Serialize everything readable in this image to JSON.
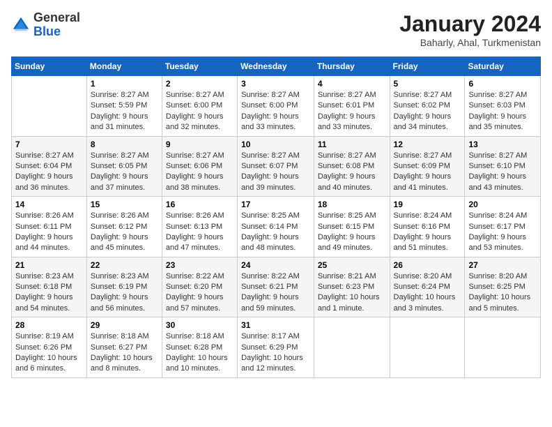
{
  "header": {
    "logo": {
      "general": "General",
      "blue": "Blue"
    },
    "title": "January 2024",
    "location": "Baharly, Ahal, Turkmenistan"
  },
  "weekdays": [
    "Sunday",
    "Monday",
    "Tuesday",
    "Wednesday",
    "Thursday",
    "Friday",
    "Saturday"
  ],
  "weeks": [
    [
      {
        "day": "",
        "sunrise": "",
        "sunset": "",
        "daylight": ""
      },
      {
        "day": "1",
        "sunrise": "Sunrise: 8:27 AM",
        "sunset": "Sunset: 5:59 PM",
        "daylight": "Daylight: 9 hours and 31 minutes."
      },
      {
        "day": "2",
        "sunrise": "Sunrise: 8:27 AM",
        "sunset": "Sunset: 6:00 PM",
        "daylight": "Daylight: 9 hours and 32 minutes."
      },
      {
        "day": "3",
        "sunrise": "Sunrise: 8:27 AM",
        "sunset": "Sunset: 6:00 PM",
        "daylight": "Daylight: 9 hours and 33 minutes."
      },
      {
        "day": "4",
        "sunrise": "Sunrise: 8:27 AM",
        "sunset": "Sunset: 6:01 PM",
        "daylight": "Daylight: 9 hours and 33 minutes."
      },
      {
        "day": "5",
        "sunrise": "Sunrise: 8:27 AM",
        "sunset": "Sunset: 6:02 PM",
        "daylight": "Daylight: 9 hours and 34 minutes."
      },
      {
        "day": "6",
        "sunrise": "Sunrise: 8:27 AM",
        "sunset": "Sunset: 6:03 PM",
        "daylight": "Daylight: 9 hours and 35 minutes."
      }
    ],
    [
      {
        "day": "7",
        "sunrise": "Sunrise: 8:27 AM",
        "sunset": "Sunset: 6:04 PM",
        "daylight": "Daylight: 9 hours and 36 minutes."
      },
      {
        "day": "8",
        "sunrise": "Sunrise: 8:27 AM",
        "sunset": "Sunset: 6:05 PM",
        "daylight": "Daylight: 9 hours and 37 minutes."
      },
      {
        "day": "9",
        "sunrise": "Sunrise: 8:27 AM",
        "sunset": "Sunset: 6:06 PM",
        "daylight": "Daylight: 9 hours and 38 minutes."
      },
      {
        "day": "10",
        "sunrise": "Sunrise: 8:27 AM",
        "sunset": "Sunset: 6:07 PM",
        "daylight": "Daylight: 9 hours and 39 minutes."
      },
      {
        "day": "11",
        "sunrise": "Sunrise: 8:27 AM",
        "sunset": "Sunset: 6:08 PM",
        "daylight": "Daylight: 9 hours and 40 minutes."
      },
      {
        "day": "12",
        "sunrise": "Sunrise: 8:27 AM",
        "sunset": "Sunset: 6:09 PM",
        "daylight": "Daylight: 9 hours and 41 minutes."
      },
      {
        "day": "13",
        "sunrise": "Sunrise: 8:27 AM",
        "sunset": "Sunset: 6:10 PM",
        "daylight": "Daylight: 9 hours and 43 minutes."
      }
    ],
    [
      {
        "day": "14",
        "sunrise": "Sunrise: 8:26 AM",
        "sunset": "Sunset: 6:11 PM",
        "daylight": "Daylight: 9 hours and 44 minutes."
      },
      {
        "day": "15",
        "sunrise": "Sunrise: 8:26 AM",
        "sunset": "Sunset: 6:12 PM",
        "daylight": "Daylight: 9 hours and 45 minutes."
      },
      {
        "day": "16",
        "sunrise": "Sunrise: 8:26 AM",
        "sunset": "Sunset: 6:13 PM",
        "daylight": "Daylight: 9 hours and 47 minutes."
      },
      {
        "day": "17",
        "sunrise": "Sunrise: 8:25 AM",
        "sunset": "Sunset: 6:14 PM",
        "daylight": "Daylight: 9 hours and 48 minutes."
      },
      {
        "day": "18",
        "sunrise": "Sunrise: 8:25 AM",
        "sunset": "Sunset: 6:15 PM",
        "daylight": "Daylight: 9 hours and 49 minutes."
      },
      {
        "day": "19",
        "sunrise": "Sunrise: 8:24 AM",
        "sunset": "Sunset: 6:16 PM",
        "daylight": "Daylight: 9 hours and 51 minutes."
      },
      {
        "day": "20",
        "sunrise": "Sunrise: 8:24 AM",
        "sunset": "Sunset: 6:17 PM",
        "daylight": "Daylight: 9 hours and 53 minutes."
      }
    ],
    [
      {
        "day": "21",
        "sunrise": "Sunrise: 8:23 AM",
        "sunset": "Sunset: 6:18 PM",
        "daylight": "Daylight: 9 hours and 54 minutes."
      },
      {
        "day": "22",
        "sunrise": "Sunrise: 8:23 AM",
        "sunset": "Sunset: 6:19 PM",
        "daylight": "Daylight: 9 hours and 56 minutes."
      },
      {
        "day": "23",
        "sunrise": "Sunrise: 8:22 AM",
        "sunset": "Sunset: 6:20 PM",
        "daylight": "Daylight: 9 hours and 57 minutes."
      },
      {
        "day": "24",
        "sunrise": "Sunrise: 8:22 AM",
        "sunset": "Sunset: 6:21 PM",
        "daylight": "Daylight: 9 hours and 59 minutes."
      },
      {
        "day": "25",
        "sunrise": "Sunrise: 8:21 AM",
        "sunset": "Sunset: 6:23 PM",
        "daylight": "Daylight: 10 hours and 1 minute."
      },
      {
        "day": "26",
        "sunrise": "Sunrise: 8:20 AM",
        "sunset": "Sunset: 6:24 PM",
        "daylight": "Daylight: 10 hours and 3 minutes."
      },
      {
        "day": "27",
        "sunrise": "Sunrise: 8:20 AM",
        "sunset": "Sunset: 6:25 PM",
        "daylight": "Daylight: 10 hours and 5 minutes."
      }
    ],
    [
      {
        "day": "28",
        "sunrise": "Sunrise: 8:19 AM",
        "sunset": "Sunset: 6:26 PM",
        "daylight": "Daylight: 10 hours and 6 minutes."
      },
      {
        "day": "29",
        "sunrise": "Sunrise: 8:18 AM",
        "sunset": "Sunset: 6:27 PM",
        "daylight": "Daylight: 10 hours and 8 minutes."
      },
      {
        "day": "30",
        "sunrise": "Sunrise: 8:18 AM",
        "sunset": "Sunset: 6:28 PM",
        "daylight": "Daylight: 10 hours and 10 minutes."
      },
      {
        "day": "31",
        "sunrise": "Sunrise: 8:17 AM",
        "sunset": "Sunset: 6:29 PM",
        "daylight": "Daylight: 10 hours and 12 minutes."
      },
      {
        "day": "",
        "sunrise": "",
        "sunset": "",
        "daylight": ""
      },
      {
        "day": "",
        "sunrise": "",
        "sunset": "",
        "daylight": ""
      },
      {
        "day": "",
        "sunrise": "",
        "sunset": "",
        "daylight": ""
      }
    ]
  ]
}
